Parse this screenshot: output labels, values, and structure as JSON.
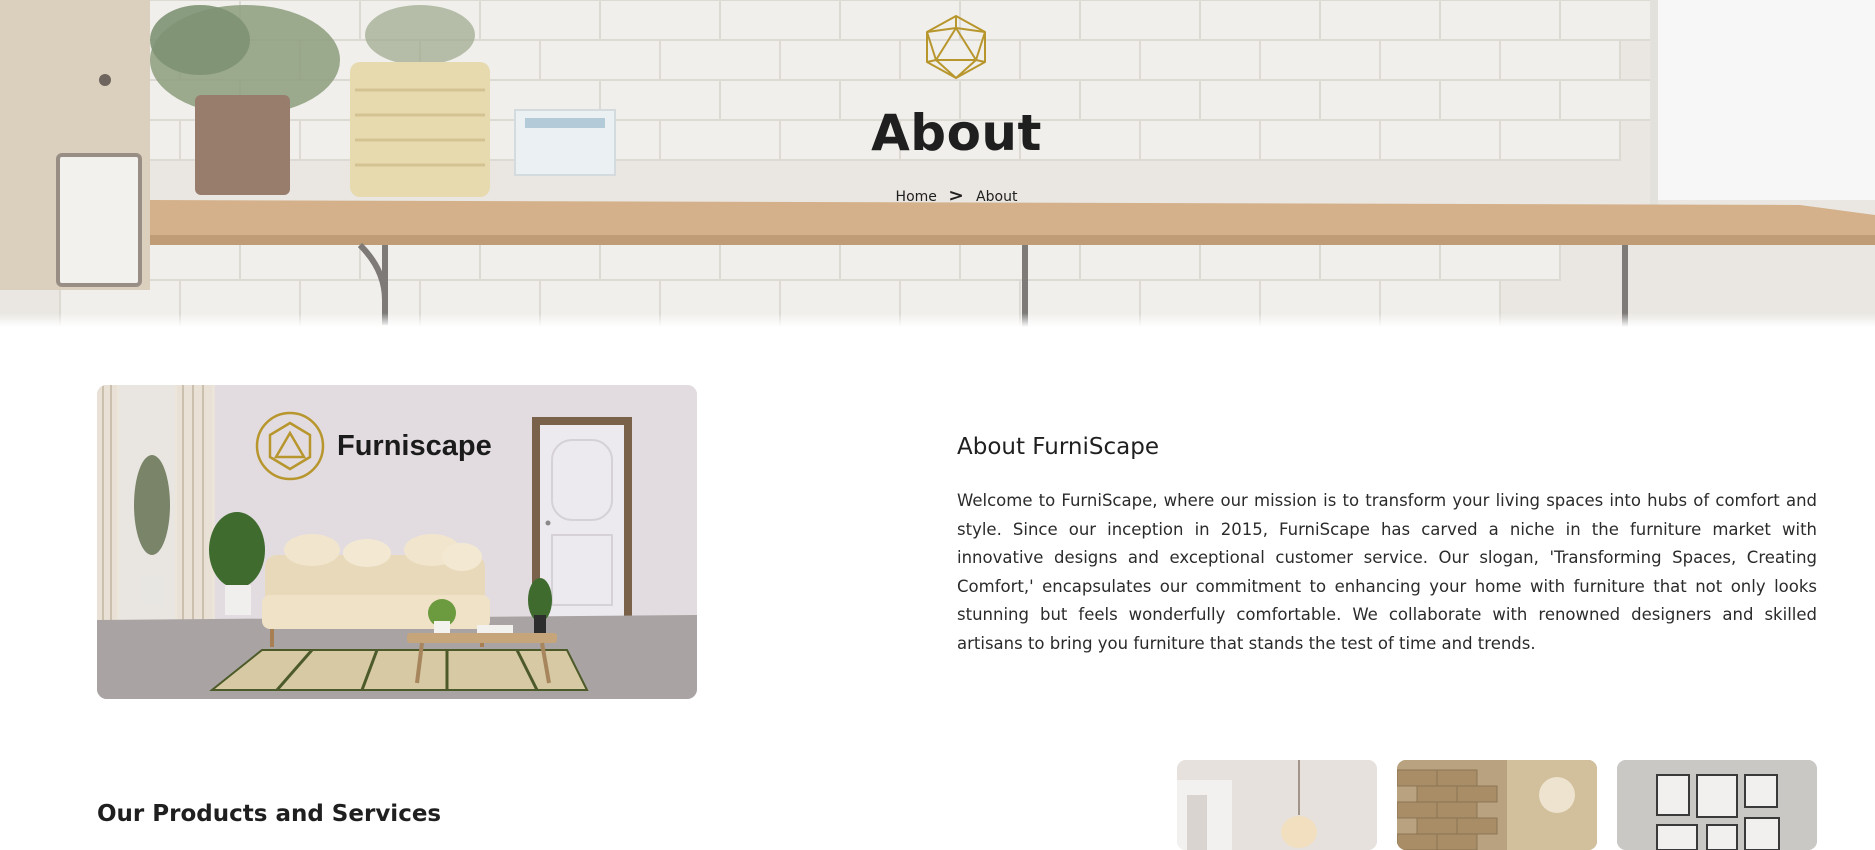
{
  "hero": {
    "title": "About",
    "breadcrumb": {
      "home": "Home",
      "separator": ">",
      "current": "About"
    }
  },
  "about": {
    "image_brand_text": "Furniscape",
    "title": "About FurniScape",
    "text": "Welcome to FurniScape, where our mission is to transform your living spaces into hubs of comfort and style. Since our inception in 2015, FurniScape has carved a niche in the furniture market with innovative designs and exceptional customer service. Our slogan, 'Transforming Spaces, Creating Comfort,' encapsulates our commitment to enhancing your home with furniture that not only looks stunning but feels wonderfully comfortable. We collaborate with renowned designers and skilled artisans to bring you furniture that stands the test of time and trends."
  },
  "products": {
    "title": "Our Products and Services"
  },
  "colors": {
    "brand_gold": "#b8962e",
    "text_dark": "#1f1f1f"
  },
  "icons": {
    "logo": "icosahedron-logo-icon",
    "breadcrumb_separator": "chevron-right-icon"
  }
}
